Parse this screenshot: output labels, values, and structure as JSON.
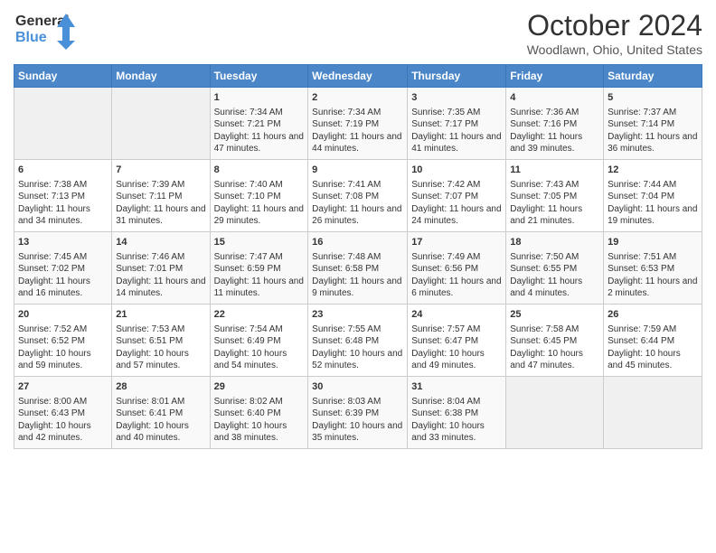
{
  "header": {
    "logo_line1": "General",
    "logo_line2": "Blue",
    "month_title": "October 2024",
    "location": "Woodlawn, Ohio, United States"
  },
  "days_of_week": [
    "Sunday",
    "Monday",
    "Tuesday",
    "Wednesday",
    "Thursday",
    "Friday",
    "Saturday"
  ],
  "weeks": [
    [
      {
        "day": "",
        "info": ""
      },
      {
        "day": "",
        "info": ""
      },
      {
        "day": "1",
        "info": "Sunrise: 7:34 AM\nSunset: 7:21 PM\nDaylight: 11 hours and 47 minutes."
      },
      {
        "day": "2",
        "info": "Sunrise: 7:34 AM\nSunset: 7:19 PM\nDaylight: 11 hours and 44 minutes."
      },
      {
        "day": "3",
        "info": "Sunrise: 7:35 AM\nSunset: 7:17 PM\nDaylight: 11 hours and 41 minutes."
      },
      {
        "day": "4",
        "info": "Sunrise: 7:36 AM\nSunset: 7:16 PM\nDaylight: 11 hours and 39 minutes."
      },
      {
        "day": "5",
        "info": "Sunrise: 7:37 AM\nSunset: 7:14 PM\nDaylight: 11 hours and 36 minutes."
      }
    ],
    [
      {
        "day": "6",
        "info": "Sunrise: 7:38 AM\nSunset: 7:13 PM\nDaylight: 11 hours and 34 minutes."
      },
      {
        "day": "7",
        "info": "Sunrise: 7:39 AM\nSunset: 7:11 PM\nDaylight: 11 hours and 31 minutes."
      },
      {
        "day": "8",
        "info": "Sunrise: 7:40 AM\nSunset: 7:10 PM\nDaylight: 11 hours and 29 minutes."
      },
      {
        "day": "9",
        "info": "Sunrise: 7:41 AM\nSunset: 7:08 PM\nDaylight: 11 hours and 26 minutes."
      },
      {
        "day": "10",
        "info": "Sunrise: 7:42 AM\nSunset: 7:07 PM\nDaylight: 11 hours and 24 minutes."
      },
      {
        "day": "11",
        "info": "Sunrise: 7:43 AM\nSunset: 7:05 PM\nDaylight: 11 hours and 21 minutes."
      },
      {
        "day": "12",
        "info": "Sunrise: 7:44 AM\nSunset: 7:04 PM\nDaylight: 11 hours and 19 minutes."
      }
    ],
    [
      {
        "day": "13",
        "info": "Sunrise: 7:45 AM\nSunset: 7:02 PM\nDaylight: 11 hours and 16 minutes."
      },
      {
        "day": "14",
        "info": "Sunrise: 7:46 AM\nSunset: 7:01 PM\nDaylight: 11 hours and 14 minutes."
      },
      {
        "day": "15",
        "info": "Sunrise: 7:47 AM\nSunset: 6:59 PM\nDaylight: 11 hours and 11 minutes."
      },
      {
        "day": "16",
        "info": "Sunrise: 7:48 AM\nSunset: 6:58 PM\nDaylight: 11 hours and 9 minutes."
      },
      {
        "day": "17",
        "info": "Sunrise: 7:49 AM\nSunset: 6:56 PM\nDaylight: 11 hours and 6 minutes."
      },
      {
        "day": "18",
        "info": "Sunrise: 7:50 AM\nSunset: 6:55 PM\nDaylight: 11 hours and 4 minutes."
      },
      {
        "day": "19",
        "info": "Sunrise: 7:51 AM\nSunset: 6:53 PM\nDaylight: 11 hours and 2 minutes."
      }
    ],
    [
      {
        "day": "20",
        "info": "Sunrise: 7:52 AM\nSunset: 6:52 PM\nDaylight: 10 hours and 59 minutes."
      },
      {
        "day": "21",
        "info": "Sunrise: 7:53 AM\nSunset: 6:51 PM\nDaylight: 10 hours and 57 minutes."
      },
      {
        "day": "22",
        "info": "Sunrise: 7:54 AM\nSunset: 6:49 PM\nDaylight: 10 hours and 54 minutes."
      },
      {
        "day": "23",
        "info": "Sunrise: 7:55 AM\nSunset: 6:48 PM\nDaylight: 10 hours and 52 minutes."
      },
      {
        "day": "24",
        "info": "Sunrise: 7:57 AM\nSunset: 6:47 PM\nDaylight: 10 hours and 49 minutes."
      },
      {
        "day": "25",
        "info": "Sunrise: 7:58 AM\nSunset: 6:45 PM\nDaylight: 10 hours and 47 minutes."
      },
      {
        "day": "26",
        "info": "Sunrise: 7:59 AM\nSunset: 6:44 PM\nDaylight: 10 hours and 45 minutes."
      }
    ],
    [
      {
        "day": "27",
        "info": "Sunrise: 8:00 AM\nSunset: 6:43 PM\nDaylight: 10 hours and 42 minutes."
      },
      {
        "day": "28",
        "info": "Sunrise: 8:01 AM\nSunset: 6:41 PM\nDaylight: 10 hours and 40 minutes."
      },
      {
        "day": "29",
        "info": "Sunrise: 8:02 AM\nSunset: 6:40 PM\nDaylight: 10 hours and 38 minutes."
      },
      {
        "day": "30",
        "info": "Sunrise: 8:03 AM\nSunset: 6:39 PM\nDaylight: 10 hours and 35 minutes."
      },
      {
        "day": "31",
        "info": "Sunrise: 8:04 AM\nSunset: 6:38 PM\nDaylight: 10 hours and 33 minutes."
      },
      {
        "day": "",
        "info": ""
      },
      {
        "day": "",
        "info": ""
      }
    ]
  ]
}
